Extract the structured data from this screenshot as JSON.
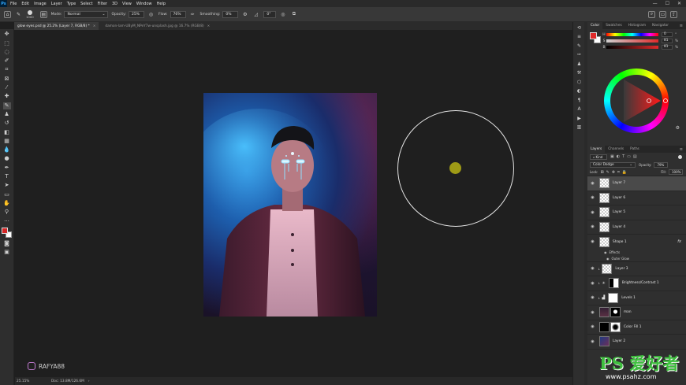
{
  "menu": [
    "File",
    "Edit",
    "Image",
    "Layer",
    "Type",
    "Select",
    "Filter",
    "3D",
    "View",
    "Window",
    "Help"
  ],
  "options": {
    "brush_size": "1000",
    "mode_label": "Mode:",
    "mode_value": "Normal",
    "opacity_label": "Opacity:",
    "opacity_value": "25%",
    "flow_label": "Flow:",
    "flow_value": "76%",
    "smoothing_label": "Smoothing:",
    "smoothing_value": "0%",
    "angle_value": "0°"
  },
  "tabs": [
    {
      "label": "glow eyes.psd @ 25.2% (Layer 7, RGB/8) *",
      "active": true
    },
    {
      "label": "damon-lam-UByM_NPeY7w-unsplash.jpg @ 16.7% (RGB/8)",
      "active": false
    }
  ],
  "status": {
    "zoom": "25.15%",
    "doc": "Doc: 13.8M/126.6M"
  },
  "watermark": {
    "handle": "RAFYA88",
    "site_main": "PS 爱好者",
    "site_url": "www.psahz.com"
  },
  "color_panel": {
    "tabs": [
      "Color",
      "Swatches",
      "Histogram",
      "Navigator"
    ],
    "fg_color": "#e02a2a",
    "bg_color": "#ffffff",
    "h_value": "0",
    "s_value": "81",
    "b_value": "81",
    "unit_deg": "°",
    "unit_pct": "%"
  },
  "layers_panel": {
    "tabs": [
      "Layers",
      "Channels",
      "Paths"
    ],
    "kind_label": "Kind",
    "blend_mode": "Color Dodge",
    "opacity_label": "Opacity:",
    "opacity_value": "79%",
    "lock_label": "Lock:",
    "fill_label": "Fill:",
    "fill_value": "100%",
    "layers": [
      {
        "name": "Layer 7",
        "selected": true
      },
      {
        "name": "Layer 6"
      },
      {
        "name": "Layer 5"
      },
      {
        "name": "Layer 4"
      },
      {
        "name": "Shape 1",
        "fx": "fx"
      },
      {
        "name": "Layer 3"
      },
      {
        "name": "Brightness/Contrast 1"
      },
      {
        "name": "Levels 1"
      },
      {
        "name": "man"
      },
      {
        "name": "Color Fill 1"
      },
      {
        "name": "Layer 2"
      }
    ],
    "effects_label": "Effects",
    "outer_glow_label": "Outer Glow"
  }
}
